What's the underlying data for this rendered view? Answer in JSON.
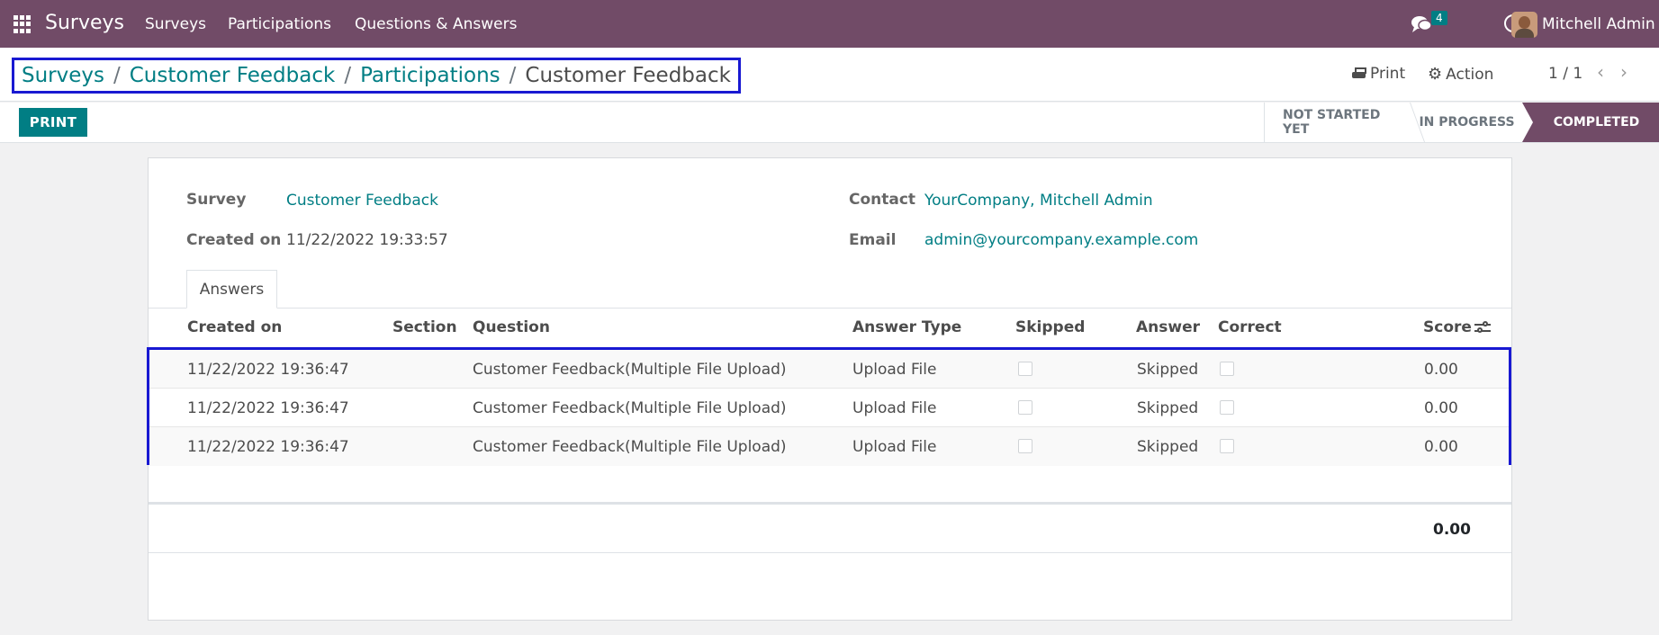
{
  "navbar": {
    "app_name": "Surveys",
    "menu": [
      "Surveys",
      "Participations",
      "Questions & Answers"
    ],
    "message_count": "4",
    "user_name": "Mitchell Admin"
  },
  "breadcrumb": {
    "items": [
      "Surveys",
      "Customer Feedback",
      "Participations"
    ],
    "separator": "/",
    "current": "Customer Feedback"
  },
  "control_panel": {
    "print_label": "Print",
    "action_label": "Action",
    "pager": "1 / 1"
  },
  "statusbar": {
    "print_button": "PRINT",
    "stages": [
      "NOT STARTED YET",
      "IN PROGRESS",
      "COMPLETED"
    ],
    "active_stage": "COMPLETED"
  },
  "form": {
    "survey_label": "Survey",
    "survey_value": "Customer Feedback",
    "created_label": "Created on",
    "created_value": "11/22/2022 19:33:57",
    "contact_label": "Contact",
    "contact_value": "YourCompany, Mitchell Admin",
    "email_label": "Email",
    "email_value": "admin@yourcompany.example.com"
  },
  "tabs": [
    "Answers"
  ],
  "table": {
    "columns": [
      "Created on",
      "Section",
      "Question",
      "Answer Type",
      "Skipped",
      "Answer",
      "Correct",
      "Score"
    ],
    "rows": [
      {
        "created": "11/22/2022 19:36:47",
        "section": "",
        "question": "Customer Feedback(Multiple File Upload)",
        "answer_type": "Upload File",
        "skipped": false,
        "answer": "Skipped",
        "correct": false,
        "score": "0.00"
      },
      {
        "created": "11/22/2022 19:36:47",
        "section": "",
        "question": "Customer Feedback(Multiple File Upload)",
        "answer_type": "Upload File",
        "skipped": false,
        "answer": "Skipped",
        "correct": false,
        "score": "0.00"
      },
      {
        "created": "11/22/2022 19:36:47",
        "section": "",
        "question": "Customer Feedback(Multiple File Upload)",
        "answer_type": "Upload File",
        "skipped": false,
        "answer": "Skipped",
        "correct": false,
        "score": "0.00"
      }
    ],
    "total_score": "0.00"
  },
  "colors": {
    "navbar": "#714b67",
    "accent": "#017e84",
    "highlight_box": "#1919d2"
  }
}
